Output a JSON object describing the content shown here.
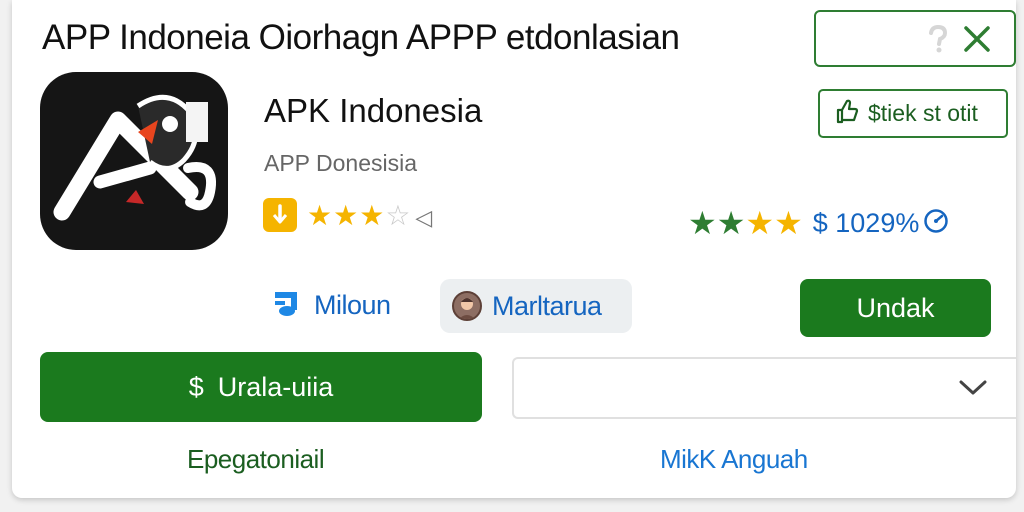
{
  "header": {
    "title": "APP Indoneia Oiorhagn APPP etdonlasian"
  },
  "app": {
    "name": "APK Indonesia",
    "subtitle": "APP Donesisia",
    "rating_stars": 3.5,
    "brand_color": "#151515",
    "accent_color": "#e8451e"
  },
  "stat_button": {
    "label": "$tiek st otit",
    "icon": "thumbs-up-icon"
  },
  "rating_summary": {
    "green_stars": 2,
    "yellow_stars": 2,
    "value_text": "$ 1029%"
  },
  "meta": {
    "developer_label": "Miloun",
    "developer_icon": "music-note-icon",
    "publisher_chip_label": "Marltarua"
  },
  "actions": {
    "secondary_label": "Undak",
    "primary_label": "Urala-uiia",
    "primary_icon_glyph": "$",
    "select_value": ""
  },
  "links": {
    "left": "Epegatoniail",
    "right": "MikK Anguah"
  },
  "colors": {
    "green": "#1b7a1e",
    "blue": "#1565c0",
    "star_yellow": "#f5b400"
  }
}
